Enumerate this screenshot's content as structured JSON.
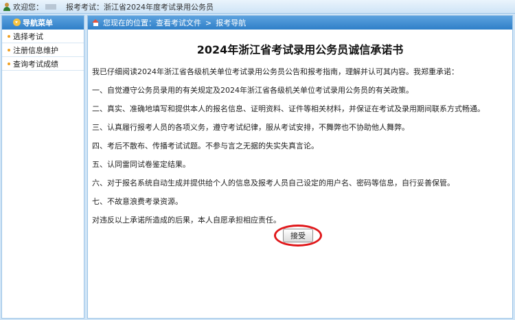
{
  "topbar": {
    "welcome": "欢迎您：",
    "exam_label": "报考考试：",
    "exam_name": "浙江省2024年度考试录用公务员"
  },
  "sidebar": {
    "title": "导航菜单",
    "items": [
      {
        "label": "选择考试"
      },
      {
        "label": "注册信息维护"
      },
      {
        "label": "查询考试成绩"
      }
    ]
  },
  "breadcrumb": {
    "prefix": "您现在的位置：查看考试文件",
    "separator": ">",
    "current": "报考导航"
  },
  "document": {
    "title": "2024年浙江省考试录用公务员诚信承诺书",
    "intro": "我已仔细阅读2024年浙江省各级机关单位考试录用公务员公告和报考指南，理解并认可其内容。我郑重承诺：",
    "items": [
      "一、自觉遵守公务员录用的有关规定及2024年浙江省各级机关单位考试录用公务员的有关政策。",
      "二、真实、准确地填写和提供本人的报名信息、证明资料、证件等相关材料，并保证在考试及录用期间联系方式畅通。",
      "三、认真履行报考人员的各项义务，遵守考试纪律，服从考试安排，不舞弊也不协助他人舞弊。",
      "四、考后不散布、传播考试试题。不参与言之无据的失实失真言论。",
      "五、认同雷同试卷鉴定结果。",
      "六、对于报名系统自动生成并提供给个人的信息及报考人员自己设定的用户名、密码等信息，自行妥善保管。",
      "七、不故意浪费考录资源。"
    ],
    "closing": "对违反以上承诺所造成的后果，本人自愿承担相应责任。",
    "accept_label": "接受"
  },
  "colors": {
    "header_blue": "#2f7fc8",
    "frame_blue": "#cfe4f6",
    "highlight_red": "#e0181b"
  }
}
